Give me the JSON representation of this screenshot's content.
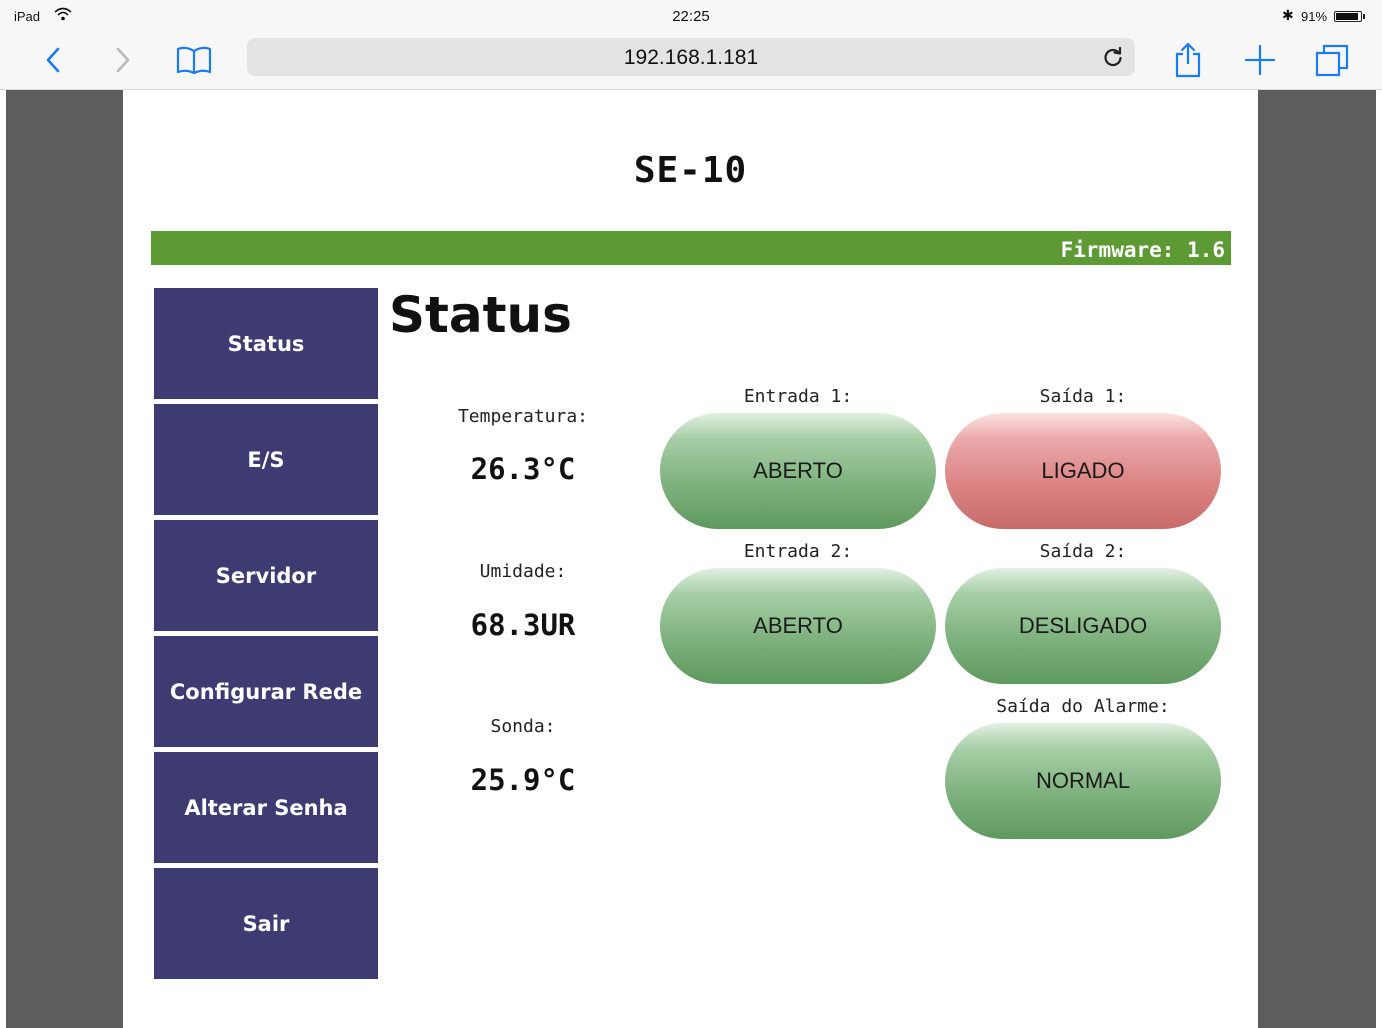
{
  "status_bar": {
    "device": "iPad",
    "time": "22:25",
    "bluetooth": "✱",
    "battery": "91%",
    "battery_level": 0.91
  },
  "browser": {
    "url": "192.168.1.181"
  },
  "page": {
    "device_title": "SE-10",
    "firmware": "Firmware: 1.6",
    "heading": "Status",
    "menu": [
      {
        "label": "Status"
      },
      {
        "label": "E/S"
      },
      {
        "label": "Servidor"
      },
      {
        "label": "Configurar Rede"
      },
      {
        "label": "Alterar Senha"
      },
      {
        "label": "Sair"
      }
    ],
    "readings": {
      "temperature_label": "Temperatura:",
      "temperature_value": "26.3°C",
      "humidity_label": "Umidade:",
      "humidity_value": "68.3UR",
      "probe_label": "Sonda:",
      "probe_value": "25.9°C"
    },
    "io": {
      "input1_label": "Entrada 1:",
      "input1_state": "ABERTO",
      "output1_label": "Saída 1:",
      "output1_state": "LIGADO",
      "input2_label": "Entrada 2:",
      "input2_state": "ABERTO",
      "output2_label": "Saída 2:",
      "output2_state": "DESLIGADO",
      "alarm_label": "Saída do Alarme:",
      "alarm_state": "NORMAL"
    }
  },
  "colors": {
    "menu_background": "#3d3b72",
    "header_bar": "#5e9a33",
    "state_green": "#7fb27f",
    "state_red": "#dc8585",
    "ios_blue": "#1a7cf5"
  }
}
